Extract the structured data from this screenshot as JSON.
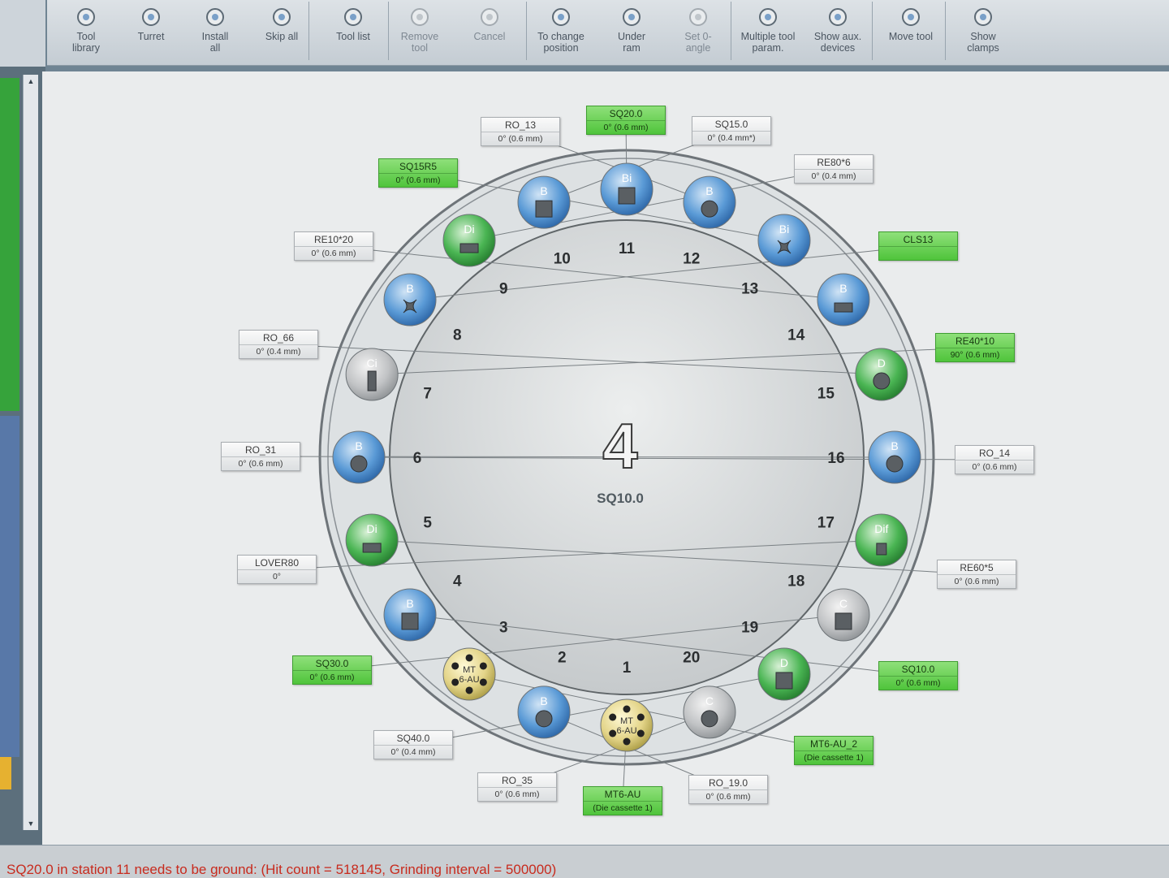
{
  "toolbar": {
    "buttons": [
      {
        "label": "Tool\nlibrary",
        "icon": "tool-library-icon",
        "disabled": false
      },
      {
        "label": "Turret",
        "icon": "turret-icon",
        "disabled": false
      },
      {
        "label": "Install\nall",
        "icon": "install-all-icon",
        "disabled": false
      },
      {
        "label": "Skip all",
        "icon": "skip-all-icon",
        "disabled": false
      },
      {
        "label": "Tool list",
        "icon": "tool-list-icon",
        "disabled": false
      },
      {
        "label": "Remove\ntool",
        "icon": "remove-tool-icon",
        "disabled": true
      },
      {
        "label": "Cancel",
        "icon": "cancel-icon",
        "disabled": true
      },
      {
        "label": "To change\nposition",
        "icon": "change-position-icon",
        "disabled": false
      },
      {
        "label": "Under\nram",
        "icon": "under-ram-icon",
        "disabled": false
      },
      {
        "label": "Set 0-\nangle",
        "icon": "set-zero-angle-icon",
        "disabled": true
      },
      {
        "label": "Multiple tool\nparam.",
        "icon": "multiple-tool-param-icon",
        "disabled": false
      },
      {
        "label": "Show aux.\ndevices",
        "icon": "show-aux-devices-icon",
        "disabled": false
      },
      {
        "label": "Move tool",
        "icon": "move-tool-icon",
        "disabled": false
      },
      {
        "label": "Show\nclamps",
        "icon": "show-clamps-icon",
        "disabled": false
      }
    ]
  },
  "turret": {
    "current_station": "4",
    "current_tool": "SQ10.0",
    "colors": {
      "blue": "#4d8fcf",
      "green": "#3faa4a",
      "grey": "#b9bcbe",
      "gold": "#d8c774",
      "label_green": "#52c43e"
    },
    "stations": [
      {
        "num": "1",
        "type": "MT\n6-AU",
        "kind": "gold",
        "label1": "MT6-AU",
        "label2": "(Die cassette 1)",
        "green": true
      },
      {
        "num": "2",
        "type": "B",
        "kind": "blue",
        "shape": "circle",
        "label1": "RO_19.0",
        "label2": "0° (0.6 mm)",
        "green": false
      },
      {
        "num": "3",
        "type": "MT\n6-AU",
        "kind": "gold",
        "label1": "MT6-AU_2",
        "label2": "(Die cassette 1)",
        "green": true
      },
      {
        "num": "4",
        "type": "B",
        "kind": "blue",
        "shape": "square",
        "label1": "SQ10.0",
        "label2": "0° (0.6 mm)",
        "green": true
      },
      {
        "num": "5",
        "type": "Di",
        "kind": "green",
        "shape": "rect",
        "label1": "RE60*5",
        "label2": "0° (0.6 mm)",
        "green": false
      },
      {
        "num": "6",
        "type": "B",
        "kind": "blue",
        "shape": "circle",
        "label1": "RO_14",
        "label2": "0° (0.6 mm)",
        "green": false
      },
      {
        "num": "7",
        "type": "Ci",
        "kind": "grey",
        "shape": "vrect",
        "label1": "RE40*10",
        "label2": "90° (0.6 mm)",
        "green": true
      },
      {
        "num": "8",
        "type": "B",
        "kind": "blue",
        "shape": "star",
        "label1": "CLS13",
        "label2": "",
        "green": true
      },
      {
        "num": "9",
        "type": "Di",
        "kind": "green",
        "shape": "rect",
        "label1": "RE80*6",
        "label2": "0° (0.4 mm)",
        "green": false
      },
      {
        "num": "10",
        "type": "B",
        "kind": "blue",
        "shape": "square",
        "label1": "SQ15.0",
        "label2": "0° (0.4 mm*)",
        "green": false
      },
      {
        "num": "11",
        "type": "Bi",
        "kind": "blue",
        "shape": "square",
        "label1": "SQ20.0",
        "label2": "0° (0.6 mm)",
        "green": true
      },
      {
        "num": "12",
        "type": "B",
        "kind": "blue",
        "shape": "circle",
        "label1": "RO_13",
        "label2": "0° (0.6 mm)",
        "green": false
      },
      {
        "num": "13",
        "type": "Bi",
        "kind": "blue",
        "shape": "star",
        "label1": "SQ15R5",
        "label2": "0° (0.6 mm)",
        "green": true
      },
      {
        "num": "14",
        "type": "B",
        "kind": "blue",
        "shape": "rect",
        "label1": "RE10*20",
        "label2": "0° (0.6 mm)",
        "green": false
      },
      {
        "num": "15",
        "type": "D",
        "kind": "green",
        "shape": "circle",
        "label1": "RO_66",
        "label2": "0° (0.4 mm)",
        "green": false
      },
      {
        "num": "16",
        "type": "B",
        "kind": "blue",
        "shape": "circle",
        "label1": "RO_31",
        "label2": "0° (0.6 mm)",
        "green": false
      },
      {
        "num": "17",
        "type": "Dif",
        "kind": "green",
        "shape": "special",
        "label1": "LOVER80",
        "label2": "0°",
        "green": false
      },
      {
        "num": "18",
        "type": "C",
        "kind": "grey",
        "shape": "square",
        "label1": "SQ30.0",
        "label2": "0° (0.6 mm)",
        "green": true
      },
      {
        "num": "19",
        "type": "D",
        "kind": "green",
        "shape": "square",
        "label1": "SQ40.0",
        "label2": "0° (0.4 mm)",
        "green": false
      },
      {
        "num": "20",
        "type": "C",
        "kind": "grey",
        "shape": "circle",
        "label1": "RO_35",
        "label2": "0° (0.6 mm)",
        "green": false
      }
    ]
  },
  "status": {
    "message": "SQ20.0 in station 11 needs to be ground: (Hit count = 518145, Grinding interval = 500000)"
  },
  "scrollbar": {
    "up": "▲",
    "down": "▼"
  }
}
